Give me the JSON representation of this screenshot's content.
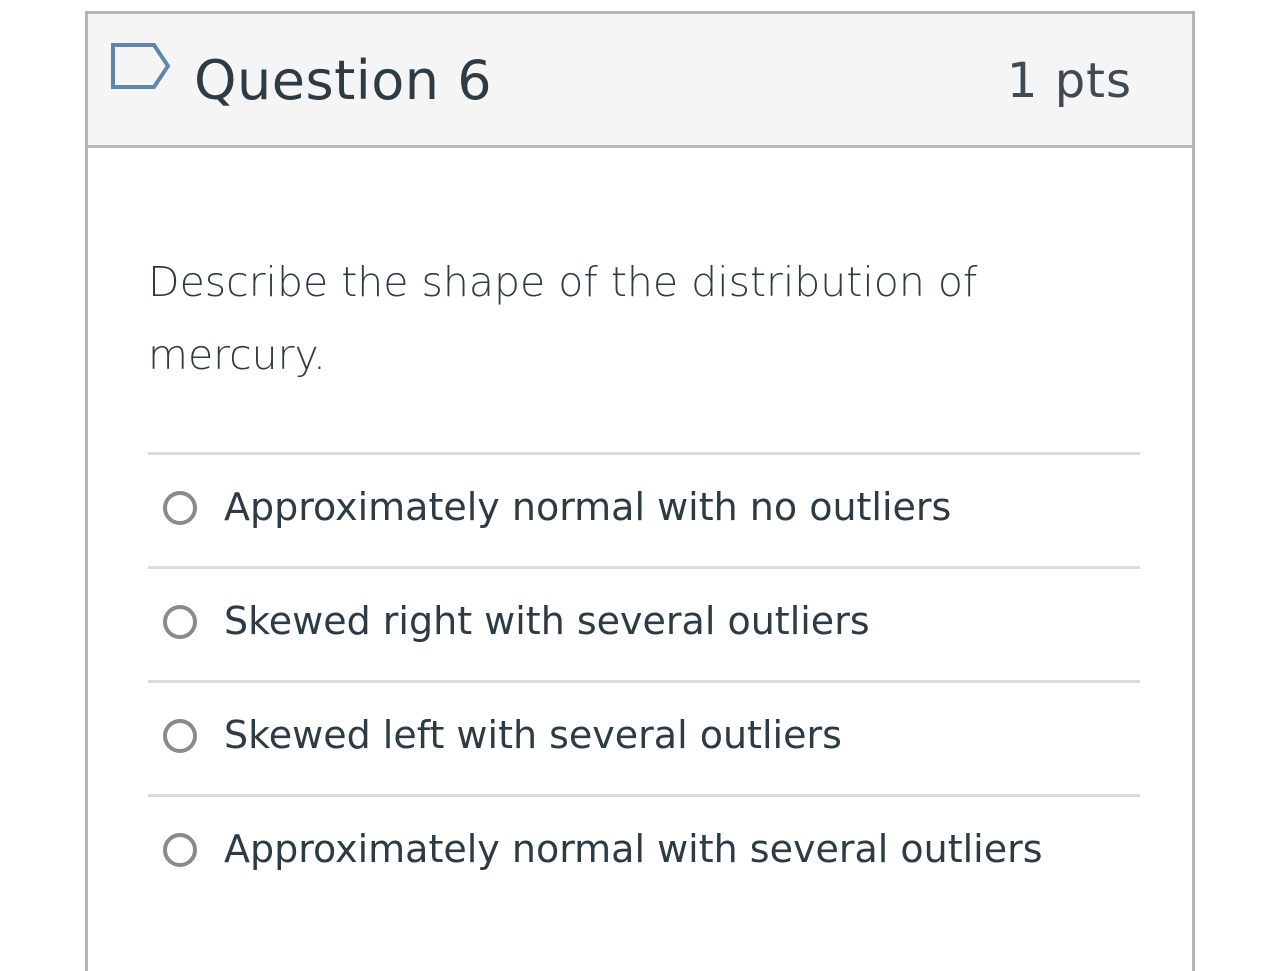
{
  "question": {
    "title": "Question 6",
    "points": "1 pts",
    "prompt_line1": "Describe the shape of the distribution of",
    "prompt_line2": "mercury.",
    "flag_icon": "flag-outline-icon",
    "accent_color": "#2d3b45"
  },
  "answers": [
    {
      "label": "Approximately normal with no outliers",
      "selected": false
    },
    {
      "label": "Skewed right with several outliers",
      "selected": false
    },
    {
      "label": "Skewed left with several outliers",
      "selected": false
    },
    {
      "label": "Approximately normal with several outliers",
      "selected": false
    }
  ]
}
